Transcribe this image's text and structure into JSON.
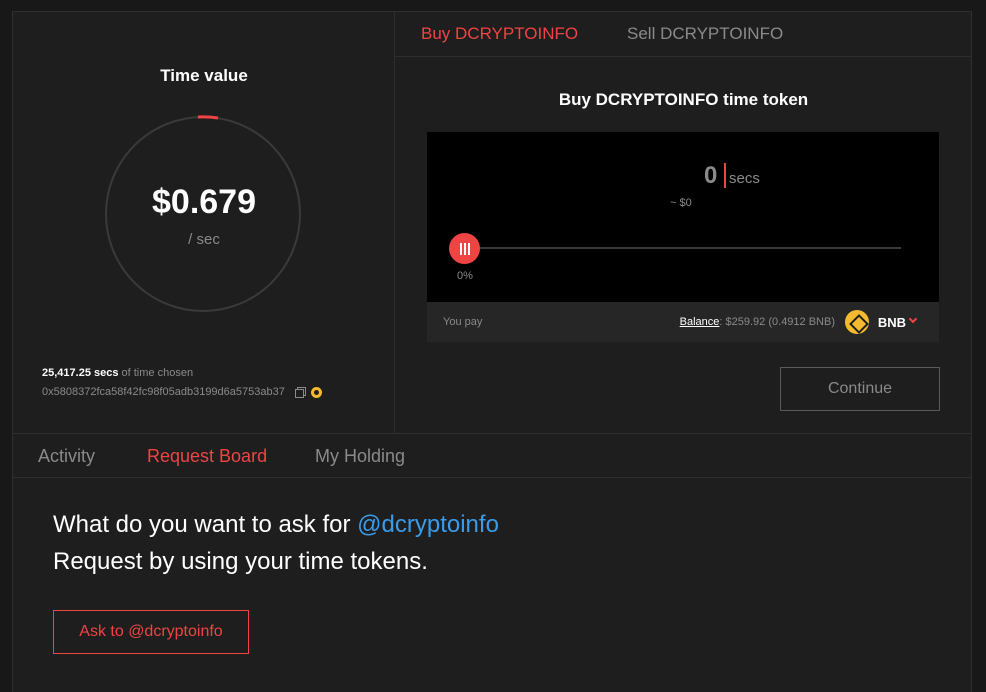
{
  "time_value": {
    "title": "Time value",
    "price": "$0.679",
    "unit": "/ sec",
    "secs_chosen": "25,417.25 secs",
    "secs_chosen_suffix": " of time chosen",
    "address": "0x5808372fca58f42fc98f05adb3199d6a5753ab37"
  },
  "trade": {
    "tabs": [
      {
        "label": "Buy DCRYPTOINFO",
        "active": true
      },
      {
        "label": "Sell DCRYPTOINFO",
        "active": false
      }
    ],
    "title": "Buy DCRYPTOINFO time token",
    "amount": "0",
    "amount_unit": "secs",
    "usd_approx": "~ $0",
    "slider_percent_label": "0%",
    "slider_fraction": 0,
    "you_pay_label": "You pay",
    "balance_label": "Balance",
    "balance_value": ": $259.92 (0.4912 BNB)",
    "currency": "BNB",
    "continue_label": "Continue"
  },
  "bottom": {
    "tabs": [
      {
        "label": "Activity",
        "active": false
      },
      {
        "label": "Request Board",
        "active": true
      },
      {
        "label": "My Holding",
        "active": false
      }
    ],
    "request_line1": "What do you want to ask for ",
    "request_handle": "@dcryptoinfo",
    "request_line2": "Request by using your time tokens.",
    "ask_button": "Ask to @dcryptoinfo"
  },
  "colors": {
    "accent": "#ef4444",
    "link": "#3b9be8",
    "bnb": "#f3ba2f"
  }
}
